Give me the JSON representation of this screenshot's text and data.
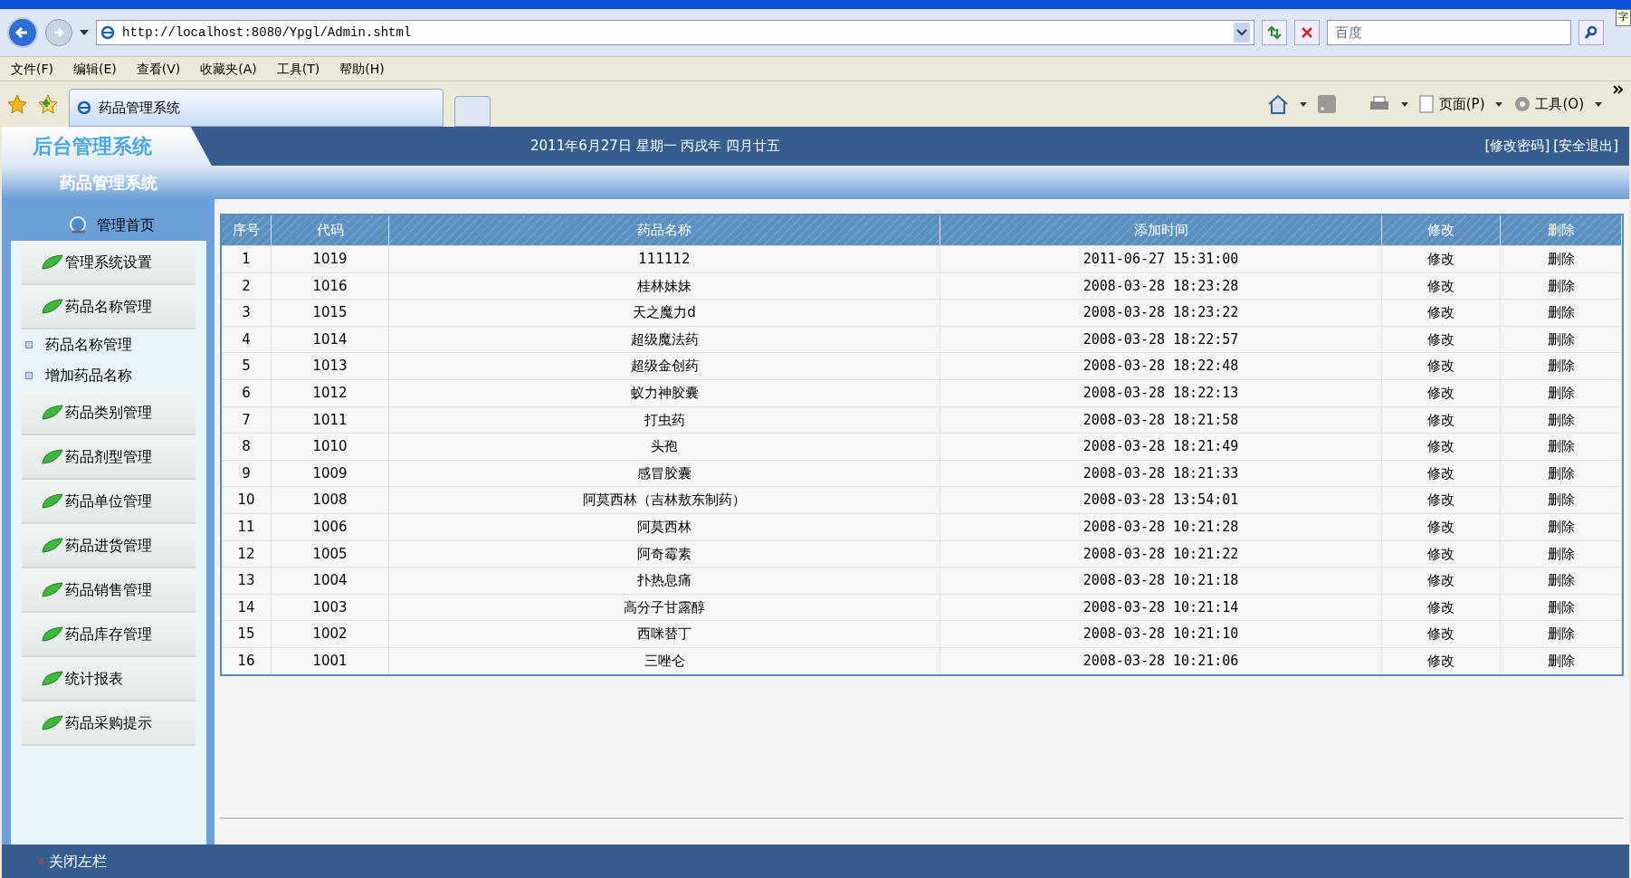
{
  "browser": {
    "address": "http://localhost:8080/Ypgl/Admin.shtml",
    "search_placeholder": "百度",
    "tooltip": "字",
    "menu": [
      "文件(F)",
      "编辑(E)",
      "查看(V)",
      "收藏夹(A)",
      "工具(T)",
      "帮助(H)"
    ],
    "tab": {
      "title": "药品管理系统"
    },
    "command_bar": [
      "页面(P)",
      "工具(O)"
    ]
  },
  "header": {
    "logo": "后台管理系统",
    "date": "2011年6月27日 星期一 丙戌年 四月廿五",
    "links": [
      "[修改密码]",
      "[安全退出]"
    ]
  },
  "subheader": "药品管理系统",
  "sidebar": {
    "home": "管理首页",
    "items": [
      {
        "label": "管理系统设置",
        "kind": "section"
      },
      {
        "label": "药品名称管理",
        "kind": "section"
      },
      {
        "label": "药品名称管理",
        "kind": "sub"
      },
      {
        "label": "增加药品名称",
        "kind": "sub"
      },
      {
        "label": "药品类别管理",
        "kind": "section"
      },
      {
        "label": "药品剂型管理",
        "kind": "section"
      },
      {
        "label": "药品单位管理",
        "kind": "section"
      },
      {
        "label": "药品进货管理",
        "kind": "section"
      },
      {
        "label": "药品销售管理",
        "kind": "section"
      },
      {
        "label": "药品库存管理",
        "kind": "section"
      },
      {
        "label": "统计报表",
        "kind": "section"
      },
      {
        "label": "药品采购提示",
        "kind": "section"
      }
    ]
  },
  "table": {
    "columns": [
      "序号",
      "代码",
      "药品名称",
      "添加时间",
      "修改",
      "删除"
    ],
    "rows": [
      [
        "1",
        "1019",
        "111112",
        "2011-06-27 15:31:00",
        "修改",
        "删除"
      ],
      [
        "2",
        "1016",
        "桂林妹妹",
        "2008-03-28 18:23:28",
        "修改",
        "删除"
      ],
      [
        "3",
        "1015",
        "天之魔力d",
        "2008-03-28 18:23:22",
        "修改",
        "删除"
      ],
      [
        "4",
        "1014",
        "超级魔法药",
        "2008-03-28 18:22:57",
        "修改",
        "删除"
      ],
      [
        "5",
        "1013",
        "超级金创药",
        "2008-03-28 18:22:48",
        "修改",
        "删除"
      ],
      [
        "6",
        "1012",
        "蚁力神胶囊",
        "2008-03-28 18:22:13",
        "修改",
        "删除"
      ],
      [
        "7",
        "1011",
        "打虫药",
        "2008-03-28 18:21:58",
        "修改",
        "删除"
      ],
      [
        "8",
        "1010",
        "头孢",
        "2008-03-28 18:21:49",
        "修改",
        "删除"
      ],
      [
        "9",
        "1009",
        "感冒胶囊",
        "2008-03-28 18:21:33",
        "修改",
        "删除"
      ],
      [
        "10",
        "1008",
        "阿莫西林（吉林敖东制药）",
        "2008-03-28 13:54:01",
        "修改",
        "删除"
      ],
      [
        "11",
        "1006",
        "阿莫西林",
        "2008-03-28 10:21:28",
        "修改",
        "删除"
      ],
      [
        "12",
        "1005",
        "阿奇霉素",
        "2008-03-28 10:21:22",
        "修改",
        "删除"
      ],
      [
        "13",
        "1004",
        "扑热息痛",
        "2008-03-28 10:21:18",
        "修改",
        "删除"
      ],
      [
        "14",
        "1003",
        "高分子甘露醇",
        "2008-03-28 10:21:14",
        "修改",
        "删除"
      ],
      [
        "15",
        "1002",
        "西咪替丁",
        "2008-03-28 10:21:10",
        "修改",
        "删除"
      ],
      [
        "16",
        "1001",
        "三唑仑",
        "2008-03-28 10:21:06",
        "修改",
        "删除"
      ]
    ]
  },
  "footer": "关闭左栏"
}
